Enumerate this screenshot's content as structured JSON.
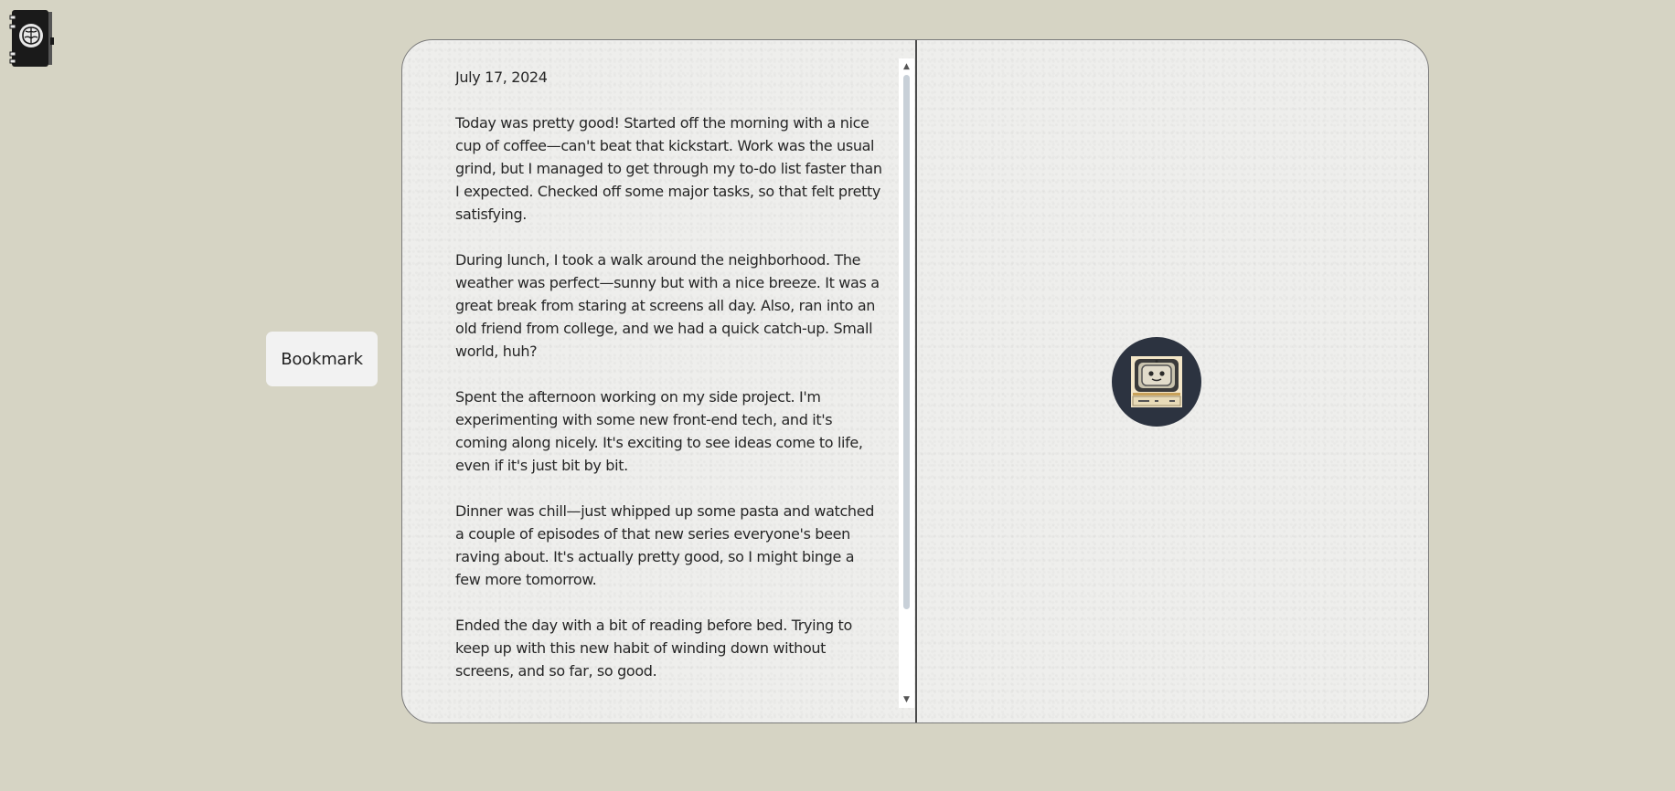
{
  "app": {
    "logo_icon": "brain-book-icon"
  },
  "sidebar": {
    "bookmark_label": "Bookmark"
  },
  "journal": {
    "date": "July 17, 2024",
    "paragraphs": [
      "Today was pretty good! Started off the morning with a nice cup of coffee—can't beat that kickstart. Work was the usual grind, but I managed to get through my to-do list faster than I expected. Checked off some major tasks, so that felt pretty satisfying.",
      "During lunch, I took a walk around the neighborhood. The weather was perfect—sunny but with a nice breeze. It was a great break from staring at screens all day. Also, ran into an old friend from college, and we had a quick catch-up. Small world, huh?",
      "Spent the afternoon working on my side project. I'm experimenting with some new front-end tech, and it's coming along nicely. It's exciting to see ideas come to life, even if it's just bit by bit.",
      "Dinner was chill—just whipped up some pasta and watched a couple of episodes of that new series everyone's been raving about. It's actually pretty good, so I might binge a few more tomorrow.",
      "Ended the day with a bit of reading before bed. Trying to keep up with this new habit of winding down without screens, and so far, so good."
    ]
  },
  "assistant": {
    "avatar_icon": "robot-computer-icon"
  },
  "colors": {
    "background": "#d6d4c4",
    "page": "#eeeeec",
    "avatar_bg": "#2c3340"
  }
}
